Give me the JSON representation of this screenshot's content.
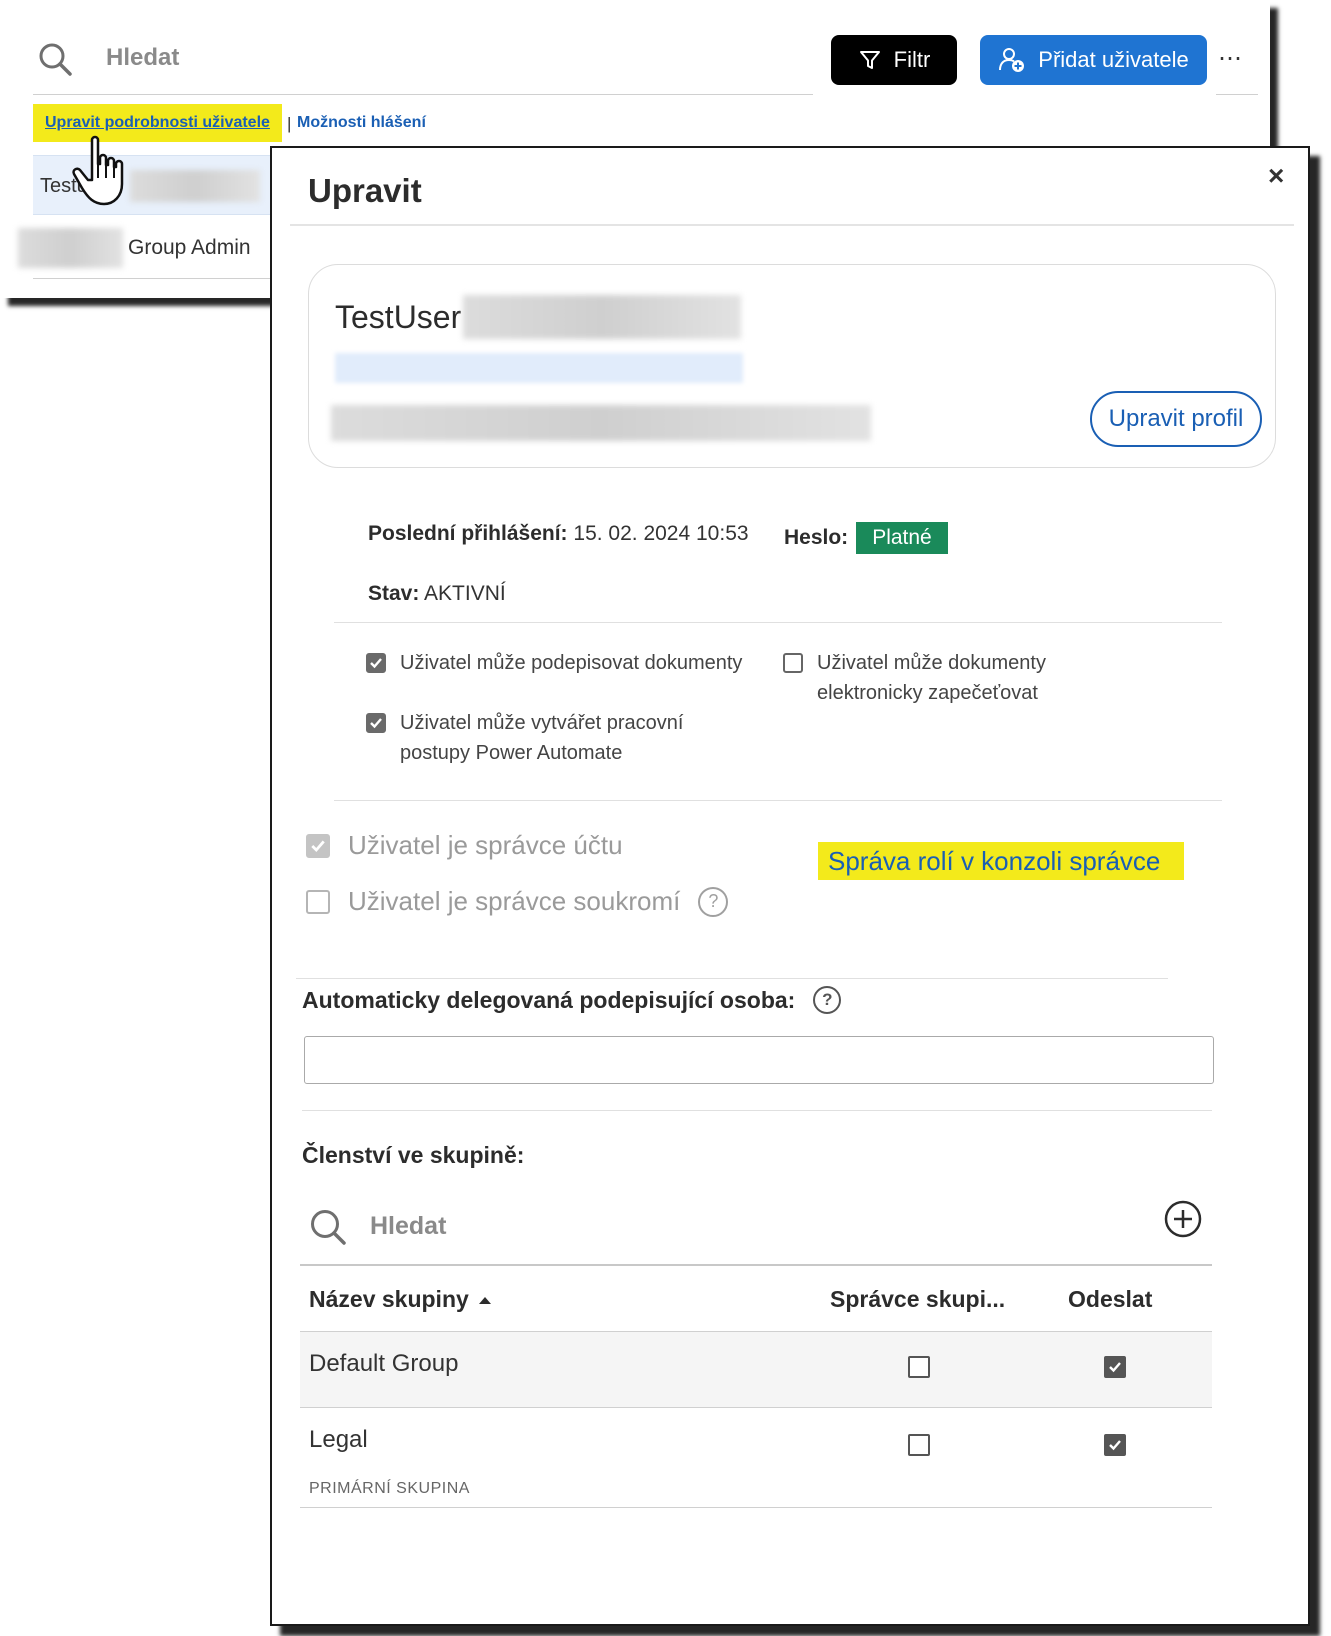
{
  "toolbar": {
    "search_placeholder": "Hledat",
    "filter_label": "Filtr",
    "add_user_label": "Přidat uživatele",
    "more_label": "⋯"
  },
  "links": {
    "edit_details": "Upravit podrobnosti uživatele",
    "separator": "|",
    "report_options": "Možnosti hlášení"
  },
  "user_list": {
    "row1_text": "Testu",
    "row2_role": "Group Admin"
  },
  "dialog": {
    "title": "Upravit",
    "close_label": "×",
    "user_name": "TestUser",
    "edit_profile_label": "Upravit profil",
    "last_login_label": "Poslední přihlášení:",
    "last_login_value": "15. 02. 2024 10:53",
    "password_label": "Heslo:",
    "password_status": "Platné",
    "state_label": "Stav:",
    "state_value": "AKTIVNÍ",
    "permissions": [
      {
        "label": "Uživatel může podepisovat dokumenty",
        "checked": true
      },
      {
        "label": "Uživatel může vytvářet pracovní postupy Power Automate",
        "checked": true
      },
      {
        "label": "Uživatel může dokumenty elektronicky zapečeťovat",
        "checked": false
      }
    ],
    "account_admin_label": "Uživatel je správce účtu",
    "account_admin_checked": true,
    "privacy_admin_label": "Uživatel je správce soukromí",
    "privacy_admin_checked": false,
    "console_link": "Správa rolí v konzoli správce",
    "delegate_label": "Automaticky delegovaná podepisující osoba:",
    "delegate_value": "",
    "group_membership_label": "Členství ve skupině:",
    "group_search_placeholder": "Hledat",
    "group_table": {
      "headers": [
        "Název skupiny",
        "Správce skupi...",
        "Odeslat"
      ],
      "rows": [
        {
          "name": "Default Group",
          "group_admin": false,
          "send": true,
          "primary_label": ""
        },
        {
          "name": "Legal",
          "group_admin": false,
          "send": true,
          "primary_label": "PRIMÁRNÍ SKUPINA"
        }
      ]
    }
  },
  "colors": {
    "accent_blue": "#1f74d2",
    "link_blue": "#1a5fb4",
    "highlight_yellow": "#f3ea1b",
    "status_green": "#1a8a5a"
  }
}
